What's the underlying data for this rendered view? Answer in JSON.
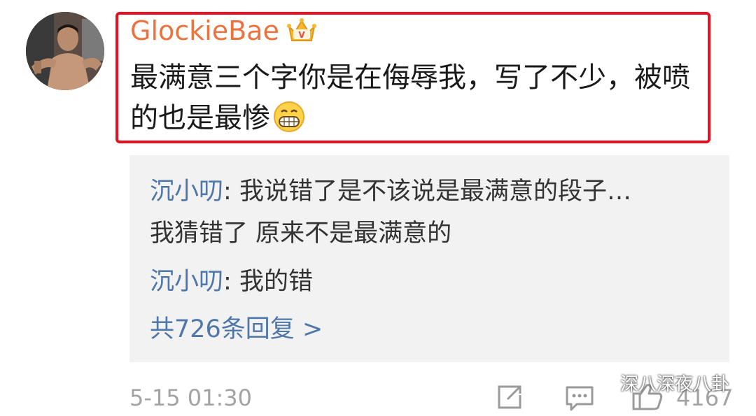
{
  "comment": {
    "username": "GlockieBae",
    "user_badge_icon": "crown-badge-icon",
    "text": "最满意三个字你是在侮辱我，写了不少，被喷的也是最惨",
    "emoji_icon": "grin-emoji-icon"
  },
  "replies": [
    {
      "author": "沉小叨",
      "separator": ": ",
      "text": "我说错了是不该说是最满意的段子…",
      "continuation": "我猜错了 原来不是最满意的"
    },
    {
      "author": "沉小叨",
      "separator": ": ",
      "text": "我的错"
    }
  ],
  "more_replies_label": "共726条回复 >",
  "footer": {
    "timestamp": "5-15 01:30",
    "share_icon": "share-icon",
    "comment_icon": "comment-icon",
    "like_icon": "thumbs-up-icon",
    "like_count": "4167"
  },
  "watermark": {
    "text": "深八深夜八卦",
    "icon": "wechat-icon"
  },
  "colors": {
    "username": "#eb7340",
    "link": "#5077aa",
    "highlight_border": "#e8101e",
    "reply_bg": "#f2f2f2",
    "muted": "#a3a3a3"
  }
}
